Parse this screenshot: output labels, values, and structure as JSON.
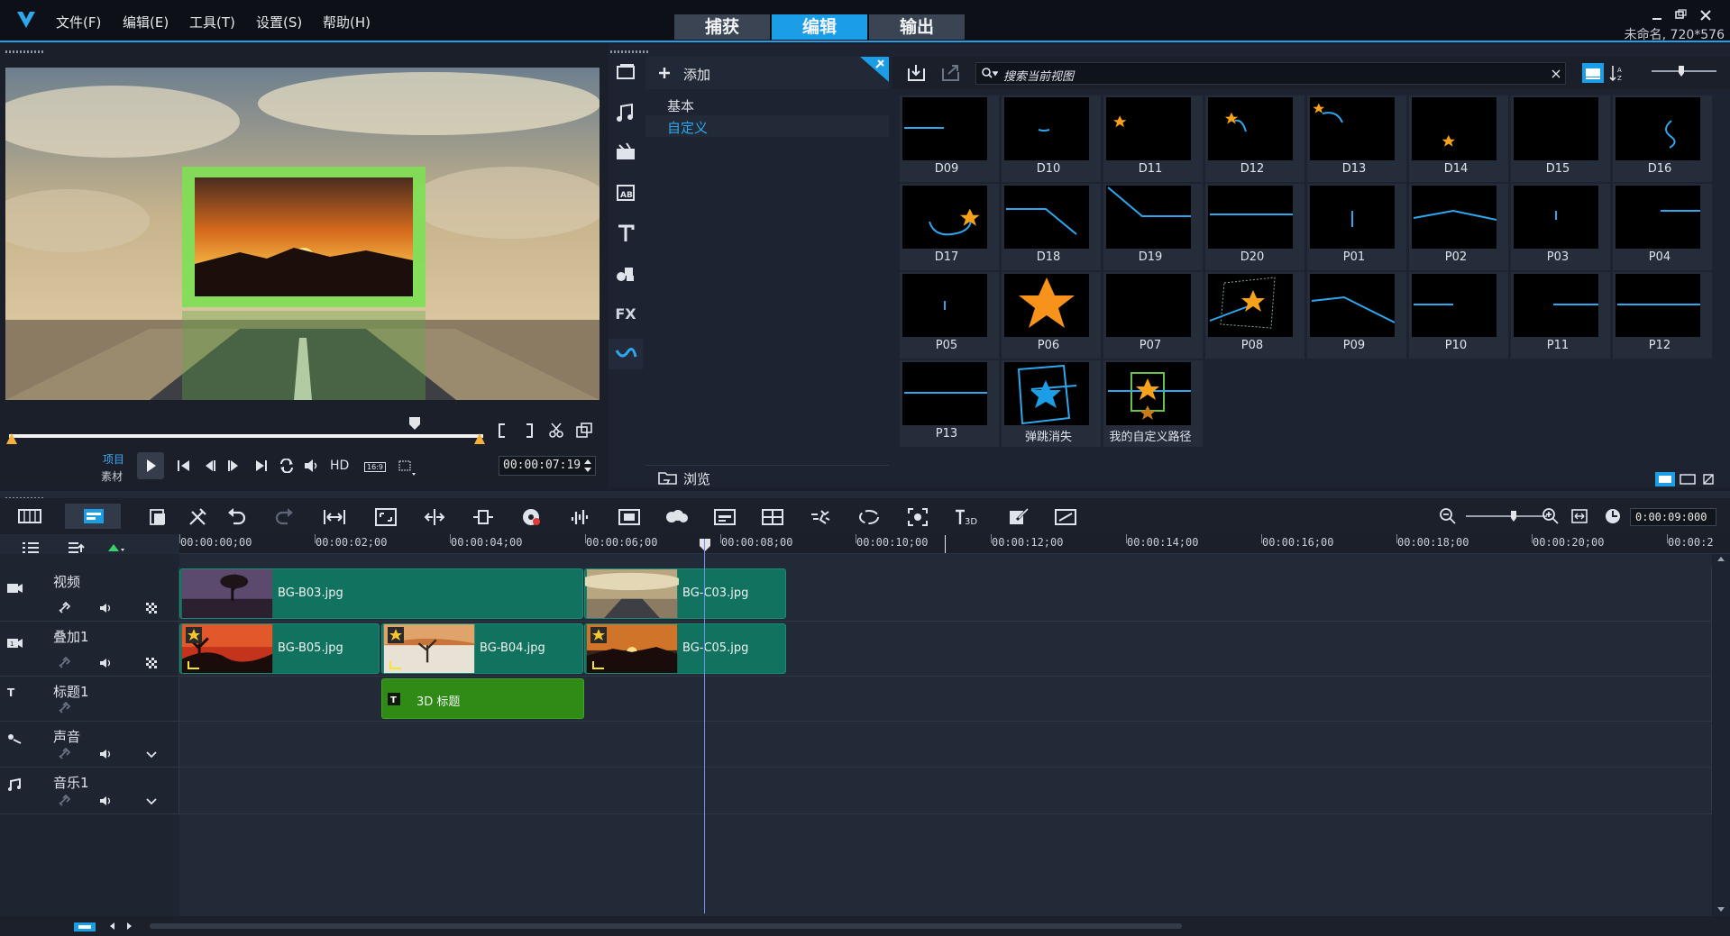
{
  "menu": [
    "文件(F)",
    "编辑(E)",
    "工具(T)",
    "设置(S)",
    "帮助(H)"
  ],
  "modes": [
    {
      "label": "捕获",
      "active": false
    },
    {
      "label": "编辑",
      "active": true
    },
    {
      "label": "输出",
      "active": false
    }
  ],
  "project": {
    "name": "未命名, 720*576"
  },
  "preview": {
    "mode_project": "项目",
    "mode_clip": "素材",
    "hd_label": "HD",
    "aspect_label": "16:9",
    "timecode": "00:00:07:19"
  },
  "library": {
    "add_label": "添加",
    "folders": [
      {
        "label": "基本",
        "active": false
      },
      {
        "label": "自定义",
        "active": true
      }
    ],
    "browse_label": "浏览",
    "search_placeholder": "搜索当前视图",
    "sidebar_icons": [
      "media-icon",
      "instant-project-icon",
      "transition-icon",
      "title-icon",
      "text-icon",
      "graphic-icon",
      "fx-icon",
      "path-icon"
    ],
    "fx_label": "FX",
    "thumbs": [
      {
        "label": "D09"
      },
      {
        "label": "D10"
      },
      {
        "label": "D11"
      },
      {
        "label": "D12"
      },
      {
        "label": "D13"
      },
      {
        "label": "D14"
      },
      {
        "label": "D15"
      },
      {
        "label": "D16"
      },
      {
        "label": "D17"
      },
      {
        "label": "D18"
      },
      {
        "label": "D19"
      },
      {
        "label": "D20"
      },
      {
        "label": "P01"
      },
      {
        "label": "P02"
      },
      {
        "label": "P03"
      },
      {
        "label": "P04"
      },
      {
        "label": "P05"
      },
      {
        "label": "P06"
      },
      {
        "label": "P07"
      },
      {
        "label": "P08"
      },
      {
        "label": "P09"
      },
      {
        "label": "P10"
      },
      {
        "label": "P11"
      },
      {
        "label": "P12"
      },
      {
        "label": "P13"
      },
      {
        "label": "弹跳消失"
      },
      {
        "label": "我的自定义路径"
      }
    ]
  },
  "timeline": {
    "duration": "0:00:09:000",
    "ruler": [
      "00:00:00;00",
      "00:00:02;00",
      "00:00:04;00",
      "00:00:06;00",
      "00:00:08;00",
      "00:00:10;00",
      "00:00:12;00",
      "00:00:14;00",
      "00:00:16;00",
      "00:00:18;00",
      "00:00:20;00",
      "00:00:2"
    ],
    "tracks": [
      {
        "name": "视频",
        "type": "video"
      },
      {
        "name": "叠加1",
        "type": "overlay"
      },
      {
        "name": "标题1",
        "type": "title"
      },
      {
        "name": "声音",
        "type": "voice"
      },
      {
        "name": "音乐1",
        "type": "music"
      }
    ],
    "clips": {
      "video": [
        "BG-B03.jpg",
        "BG-C03.jpg"
      ],
      "overlay": [
        "BG-B05.jpg",
        "BG-B04.jpg",
        "BG-C05.jpg"
      ],
      "title": [
        "3D 标题"
      ]
    }
  },
  "colors": {
    "accent": "#1c9ee6",
    "clip_green": "#11735f",
    "title_clip": "#2f8a16"
  }
}
